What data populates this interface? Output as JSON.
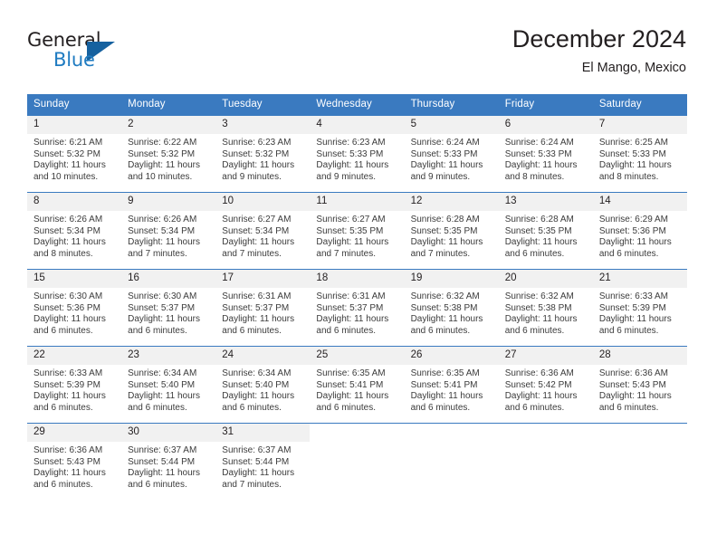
{
  "brand": {
    "name_part1": "General",
    "name_part2": "Blue",
    "triangle_color": "#15619f",
    "blue_color": "#1f7bc1"
  },
  "header": {
    "title": "December 2024",
    "subtitle": "El Mango, Mexico"
  },
  "theme": {
    "header_blue": "#3a7ac0",
    "daynum_gray": "#f1f1f1",
    "text_color": "#231f20"
  },
  "calendar": {
    "weekday_headers": [
      "Sunday",
      "Monday",
      "Tuesday",
      "Wednesday",
      "Thursday",
      "Friday",
      "Saturday"
    ],
    "weeks": [
      [
        {
          "day": "1",
          "sunrise": "Sunrise: 6:21 AM",
          "sunset": "Sunset: 5:32 PM",
          "daylight1": "Daylight: 11 hours",
          "daylight2": "and 10 minutes."
        },
        {
          "day": "2",
          "sunrise": "Sunrise: 6:22 AM",
          "sunset": "Sunset: 5:32 PM",
          "daylight1": "Daylight: 11 hours",
          "daylight2": "and 10 minutes."
        },
        {
          "day": "3",
          "sunrise": "Sunrise: 6:23 AM",
          "sunset": "Sunset: 5:32 PM",
          "daylight1": "Daylight: 11 hours",
          "daylight2": "and 9 minutes."
        },
        {
          "day": "4",
          "sunrise": "Sunrise: 6:23 AM",
          "sunset": "Sunset: 5:33 PM",
          "daylight1": "Daylight: 11 hours",
          "daylight2": "and 9 minutes."
        },
        {
          "day": "5",
          "sunrise": "Sunrise: 6:24 AM",
          "sunset": "Sunset: 5:33 PM",
          "daylight1": "Daylight: 11 hours",
          "daylight2": "and 9 minutes."
        },
        {
          "day": "6",
          "sunrise": "Sunrise: 6:24 AM",
          "sunset": "Sunset: 5:33 PM",
          "daylight1": "Daylight: 11 hours",
          "daylight2": "and 8 minutes."
        },
        {
          "day": "7",
          "sunrise": "Sunrise: 6:25 AM",
          "sunset": "Sunset: 5:33 PM",
          "daylight1": "Daylight: 11 hours",
          "daylight2": "and 8 minutes."
        }
      ],
      [
        {
          "day": "8",
          "sunrise": "Sunrise: 6:26 AM",
          "sunset": "Sunset: 5:34 PM",
          "daylight1": "Daylight: 11 hours",
          "daylight2": "and 8 minutes."
        },
        {
          "day": "9",
          "sunrise": "Sunrise: 6:26 AM",
          "sunset": "Sunset: 5:34 PM",
          "daylight1": "Daylight: 11 hours",
          "daylight2": "and 7 minutes."
        },
        {
          "day": "10",
          "sunrise": "Sunrise: 6:27 AM",
          "sunset": "Sunset: 5:34 PM",
          "daylight1": "Daylight: 11 hours",
          "daylight2": "and 7 minutes."
        },
        {
          "day": "11",
          "sunrise": "Sunrise: 6:27 AM",
          "sunset": "Sunset: 5:35 PM",
          "daylight1": "Daylight: 11 hours",
          "daylight2": "and 7 minutes."
        },
        {
          "day": "12",
          "sunrise": "Sunrise: 6:28 AM",
          "sunset": "Sunset: 5:35 PM",
          "daylight1": "Daylight: 11 hours",
          "daylight2": "and 7 minutes."
        },
        {
          "day": "13",
          "sunrise": "Sunrise: 6:28 AM",
          "sunset": "Sunset: 5:35 PM",
          "daylight1": "Daylight: 11 hours",
          "daylight2": "and 6 minutes."
        },
        {
          "day": "14",
          "sunrise": "Sunrise: 6:29 AM",
          "sunset": "Sunset: 5:36 PM",
          "daylight1": "Daylight: 11 hours",
          "daylight2": "and 6 minutes."
        }
      ],
      [
        {
          "day": "15",
          "sunrise": "Sunrise: 6:30 AM",
          "sunset": "Sunset: 5:36 PM",
          "daylight1": "Daylight: 11 hours",
          "daylight2": "and 6 minutes."
        },
        {
          "day": "16",
          "sunrise": "Sunrise: 6:30 AM",
          "sunset": "Sunset: 5:37 PM",
          "daylight1": "Daylight: 11 hours",
          "daylight2": "and 6 minutes."
        },
        {
          "day": "17",
          "sunrise": "Sunrise: 6:31 AM",
          "sunset": "Sunset: 5:37 PM",
          "daylight1": "Daylight: 11 hours",
          "daylight2": "and 6 minutes."
        },
        {
          "day": "18",
          "sunrise": "Sunrise: 6:31 AM",
          "sunset": "Sunset: 5:37 PM",
          "daylight1": "Daylight: 11 hours",
          "daylight2": "and 6 minutes."
        },
        {
          "day": "19",
          "sunrise": "Sunrise: 6:32 AM",
          "sunset": "Sunset: 5:38 PM",
          "daylight1": "Daylight: 11 hours",
          "daylight2": "and 6 minutes."
        },
        {
          "day": "20",
          "sunrise": "Sunrise: 6:32 AM",
          "sunset": "Sunset: 5:38 PM",
          "daylight1": "Daylight: 11 hours",
          "daylight2": "and 6 minutes."
        },
        {
          "day": "21",
          "sunrise": "Sunrise: 6:33 AM",
          "sunset": "Sunset: 5:39 PM",
          "daylight1": "Daylight: 11 hours",
          "daylight2": "and 6 minutes."
        }
      ],
      [
        {
          "day": "22",
          "sunrise": "Sunrise: 6:33 AM",
          "sunset": "Sunset: 5:39 PM",
          "daylight1": "Daylight: 11 hours",
          "daylight2": "and 6 minutes."
        },
        {
          "day": "23",
          "sunrise": "Sunrise: 6:34 AM",
          "sunset": "Sunset: 5:40 PM",
          "daylight1": "Daylight: 11 hours",
          "daylight2": "and 6 minutes."
        },
        {
          "day": "24",
          "sunrise": "Sunrise: 6:34 AM",
          "sunset": "Sunset: 5:40 PM",
          "daylight1": "Daylight: 11 hours",
          "daylight2": "and 6 minutes."
        },
        {
          "day": "25",
          "sunrise": "Sunrise: 6:35 AM",
          "sunset": "Sunset: 5:41 PM",
          "daylight1": "Daylight: 11 hours",
          "daylight2": "and 6 minutes."
        },
        {
          "day": "26",
          "sunrise": "Sunrise: 6:35 AM",
          "sunset": "Sunset: 5:41 PM",
          "daylight1": "Daylight: 11 hours",
          "daylight2": "and 6 minutes."
        },
        {
          "day": "27",
          "sunrise": "Sunrise: 6:36 AM",
          "sunset": "Sunset: 5:42 PM",
          "daylight1": "Daylight: 11 hours",
          "daylight2": "and 6 minutes."
        },
        {
          "day": "28",
          "sunrise": "Sunrise: 6:36 AM",
          "sunset": "Sunset: 5:43 PM",
          "daylight1": "Daylight: 11 hours",
          "daylight2": "and 6 minutes."
        }
      ],
      [
        {
          "day": "29",
          "sunrise": "Sunrise: 6:36 AM",
          "sunset": "Sunset: 5:43 PM",
          "daylight1": "Daylight: 11 hours",
          "daylight2": "and 6 minutes."
        },
        {
          "day": "30",
          "sunrise": "Sunrise: 6:37 AM",
          "sunset": "Sunset: 5:44 PM",
          "daylight1": "Daylight: 11 hours",
          "daylight2": "and 6 minutes."
        },
        {
          "day": "31",
          "sunrise": "Sunrise: 6:37 AM",
          "sunset": "Sunset: 5:44 PM",
          "daylight1": "Daylight: 11 hours",
          "daylight2": "and 7 minutes."
        },
        {
          "day": "",
          "sunrise": "",
          "sunset": "",
          "daylight1": "",
          "daylight2": ""
        },
        {
          "day": "",
          "sunrise": "",
          "sunset": "",
          "daylight1": "",
          "daylight2": ""
        },
        {
          "day": "",
          "sunrise": "",
          "sunset": "",
          "daylight1": "",
          "daylight2": ""
        },
        {
          "day": "",
          "sunrise": "",
          "sunset": "",
          "daylight1": "",
          "daylight2": ""
        }
      ]
    ]
  }
}
